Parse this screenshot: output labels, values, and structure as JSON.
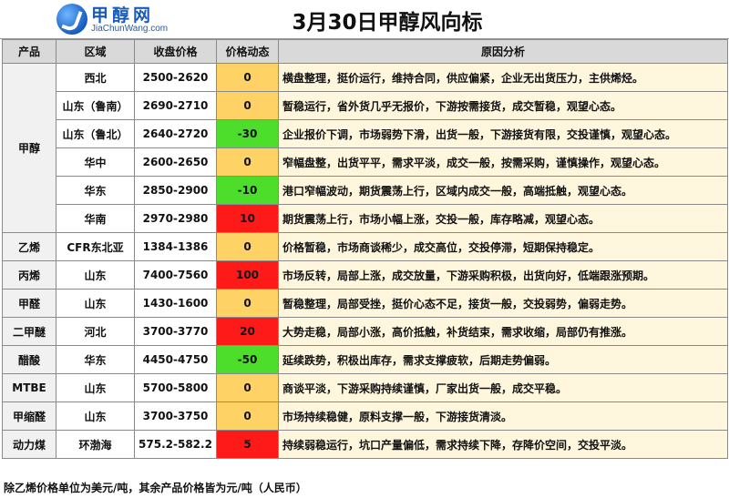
{
  "logo": {
    "name": "甲醇网",
    "domain": "JiaChunWang.com"
  },
  "title": "3月30日甲醇风向标",
  "columns": {
    "product": "产品",
    "region": "区域",
    "price": "收盘价格",
    "change": "价格动态",
    "reason": "原因分析"
  },
  "rows": [
    {
      "product": "甲醇",
      "region": "西北",
      "price": "2500-2620",
      "change": "0",
      "trend": "flat",
      "reason": "横盘整理，挺价运行，维持合同，供应偏紧，企业无出货压力，主供烯烃。"
    },
    {
      "product": "甲醇",
      "region": "山东（鲁南）",
      "price": "2690-2710",
      "change": "0",
      "trend": "flat",
      "reason": "暂稳运行，省外货几乎无报价，下游按需接货，成交暂稳，观望心态。"
    },
    {
      "product": "甲醇",
      "region": "山东（鲁北）",
      "price": "2640-2720",
      "change": "-30",
      "trend": "down",
      "reason": "企业报价下调，市场弱势下滑，出货一般，下游接货有限，交投谨慎，观望心态。"
    },
    {
      "product": "甲醇",
      "region": "华中",
      "price": "2600-2650",
      "change": "0",
      "trend": "flat",
      "reason": "窄幅盘整，出货平平，需求平淡，成交一般，按需采购，谨慎操作，观望心态。"
    },
    {
      "product": "甲醇",
      "region": "华东",
      "price": "2850-2900",
      "change": "-10",
      "trend": "down",
      "reason": "港口窄幅波动，期货震荡上行，区域内成交一般，高端抵触，观望心态。"
    },
    {
      "product": "甲醇",
      "region": "华南",
      "price": "2970-2980",
      "change": "10",
      "trend": "up",
      "reason": "期货震荡上行，市场小幅上涨，交投一般，库存略减，观望心态。"
    },
    {
      "product": "乙烯",
      "region": "CFR东北亚",
      "price": "1384-1386",
      "change": "0",
      "trend": "flat",
      "reason": "价格暂稳，市场商谈稀少，成交高位，交投停滞，短期保持稳定。"
    },
    {
      "product": "丙烯",
      "region": "山东",
      "price": "7400-7560",
      "change": "100",
      "trend": "up",
      "reason": "市场反转，局部上涨，成交放量，下游采购积极，出货向好，低端跟涨预期。"
    },
    {
      "product": "甲醛",
      "region": "山东",
      "price": "1430-1600",
      "change": "0",
      "trend": "flat",
      "reason": "暂稳整理，局部受挫，挺价心态不足，接货一般，交投弱势，偏弱走势。"
    },
    {
      "product": "二甲醚",
      "region": "河北",
      "price": "3700-3770",
      "change": "20",
      "trend": "up",
      "reason": "大势走稳，局部小涨，高价抵触，补货结束，需求收缩，局部仍有推涨。"
    },
    {
      "product": "醋酸",
      "region": "华东",
      "price": "4450-4750",
      "change": "-50",
      "trend": "down",
      "reason": "延续跌势，积极出库存，需求支撑疲软，后期走势偏弱。"
    },
    {
      "product": "MTBE",
      "region": "山东",
      "price": "5700-5800",
      "change": "0",
      "trend": "flat",
      "reason": "商谈平淡，下游采购持续谨慎，厂家出货一般，成交平稳。"
    },
    {
      "product": "甲缩醛",
      "region": "山东",
      "price": "3700-3750",
      "change": "0",
      "trend": "flat",
      "reason": "市场持续稳健，原料支撑一般，下游接货清淡。"
    },
    {
      "product": "动力煤",
      "region": "环渤海",
      "price": "575.2-582.2",
      "change": "5",
      "trend": "up",
      "reason": "持续弱稳运行，坑口产量偏低，需求持续下降，存降价空间，交投平淡。"
    }
  ],
  "footnote": "除乙烯价格单位为美元/吨，其余产品价格皆为元/吨（人民币）",
  "colors": {
    "flat": "#ffd265",
    "down": "#4ddd2b",
    "up": "#ff1a1a",
    "header_bg": "#d9d9d9",
    "reason_bg": "#fff7dd"
  }
}
